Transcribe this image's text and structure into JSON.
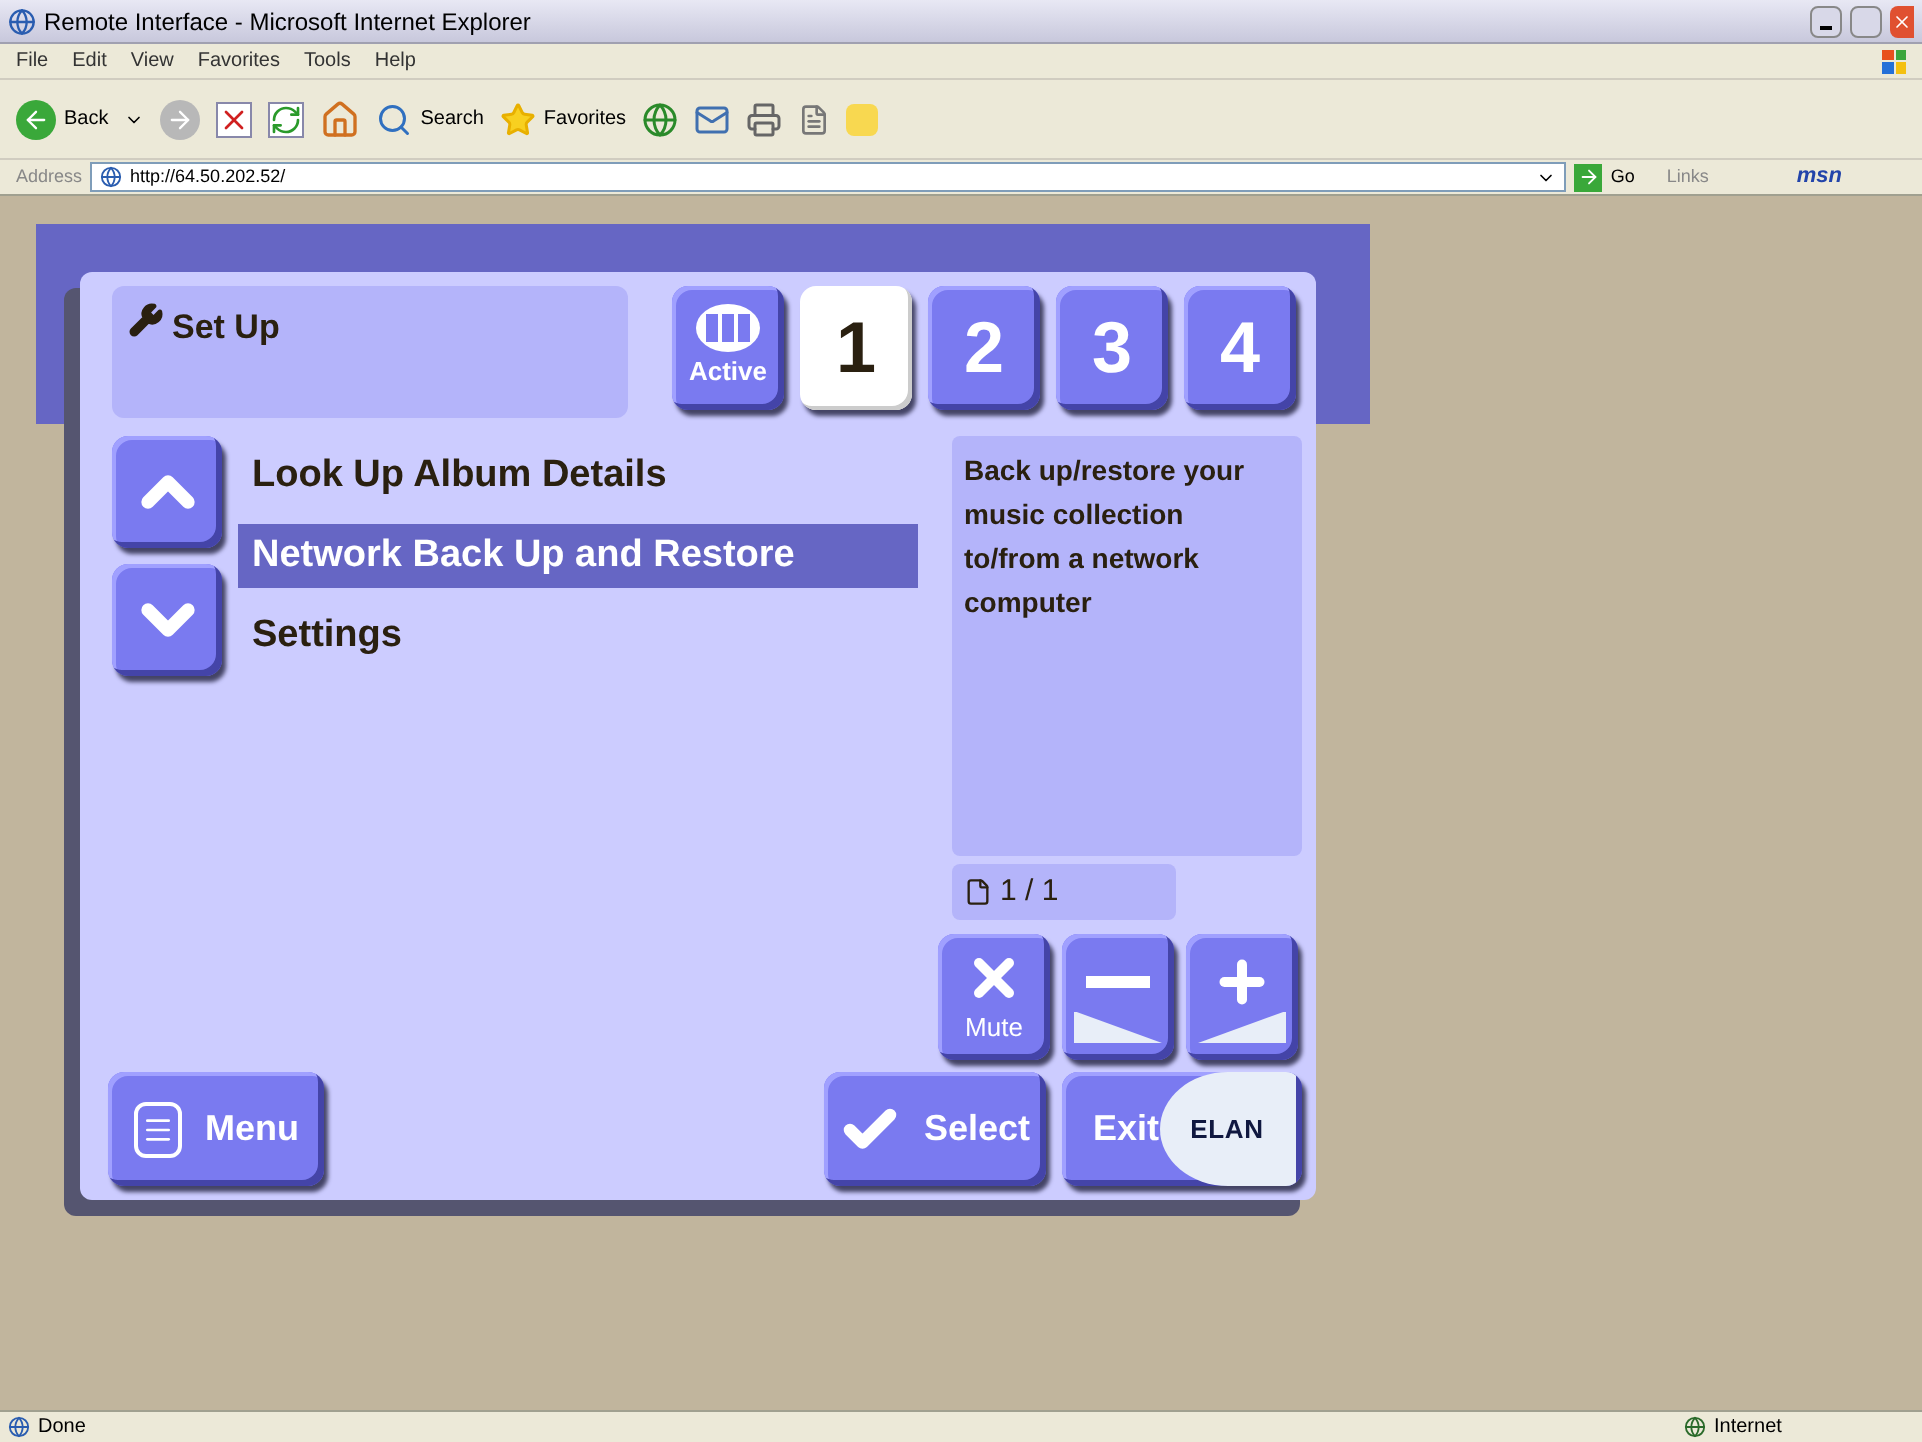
{
  "window": {
    "title": "Remote Interface - Microsoft Internet Explorer"
  },
  "menu": [
    "File",
    "Edit",
    "View",
    "Favorites",
    "Tools",
    "Help"
  ],
  "toolbar": {
    "back": "Back",
    "search": "Search",
    "favorites": "Favorites"
  },
  "address": {
    "label": "Address",
    "url": "http://64.50.202.52/",
    "go": "Go",
    "links": "Links",
    "msn": "msn"
  },
  "remote": {
    "title": "Set Up",
    "active_label": "Active",
    "zones": [
      {
        "label": "1",
        "selected": true
      },
      {
        "label": "2",
        "selected": false
      },
      {
        "label": "3",
        "selected": false
      },
      {
        "label": "4",
        "selected": false
      }
    ],
    "items": [
      {
        "label": "Look Up Album Details",
        "selected": false
      },
      {
        "label": "Network Back Up and Restore",
        "selected": true
      },
      {
        "label": "Settings",
        "selected": false
      }
    ],
    "description": "Back up/restore your music collection to/from a network computer",
    "page": "1 / 1",
    "mute": "Mute",
    "menu": "Menu",
    "select": "Select",
    "exit": "Exit",
    "logo": "ELAN"
  },
  "status_bar": {
    "text": "Done",
    "zone": "Internet"
  }
}
